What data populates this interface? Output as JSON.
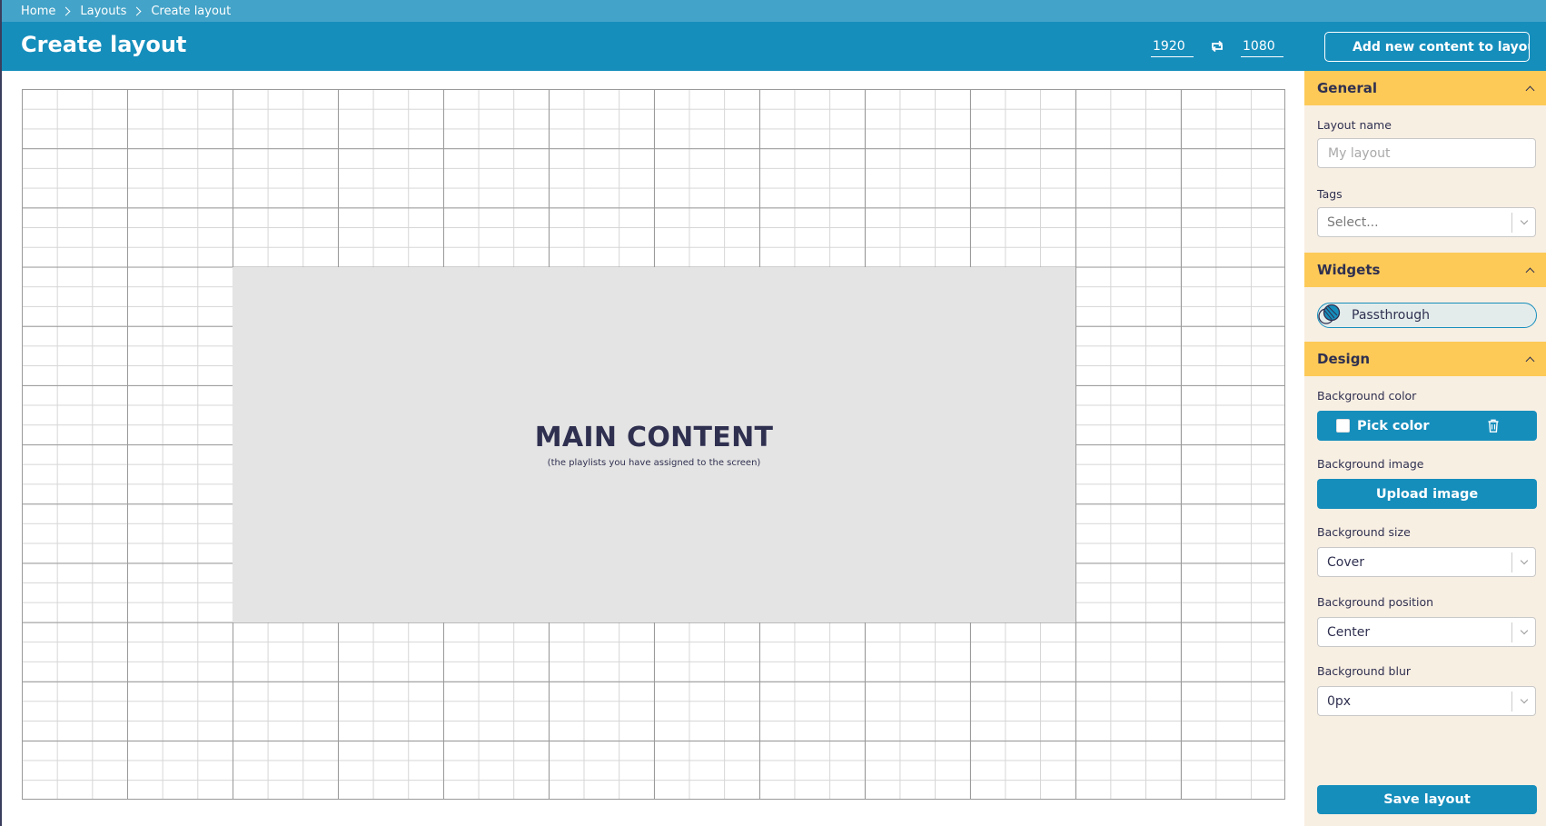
{
  "breadcrumb": {
    "items": [
      "Home",
      "Layouts",
      "Create layout"
    ]
  },
  "header": {
    "title": "Create layout",
    "width_value": "1920",
    "height_value": "1080",
    "swap_icon": "swap-dimensions-icon",
    "add_content_label": "Add new content to layout"
  },
  "canvas": {
    "region_title": "MAIN CONTENT",
    "region_subtitle": "(the playlists you have assigned to the screen)"
  },
  "sidebar": {
    "general": {
      "title": "General",
      "layout_name_label": "Layout name",
      "layout_name_placeholder": "My layout",
      "tags_label": "Tags",
      "tags_placeholder": "Select..."
    },
    "widgets": {
      "title": "Widgets",
      "items": [
        {
          "label": "Passthrough",
          "icon": "passthrough-icon"
        }
      ]
    },
    "design": {
      "title": "Design",
      "bg_color_label": "Background color",
      "pick_color_label": "Pick color",
      "bg_image_label": "Background image",
      "upload_image_label": "Upload image",
      "bg_size_label": "Background size",
      "bg_size_value": "Cover",
      "bg_position_label": "Background position",
      "bg_position_value": "Center",
      "bg_blur_label": "Background blur",
      "bg_blur_value": "0px"
    },
    "save_label": "Save layout"
  },
  "colors": {
    "primary": "#168ebc",
    "breadcrumb_bar": "#44a3c8",
    "section_header": "#fdca58",
    "sidebar_bg": "#f8efe3",
    "region_bg": "#e4e4e4",
    "text_dark": "#2f3050"
  }
}
